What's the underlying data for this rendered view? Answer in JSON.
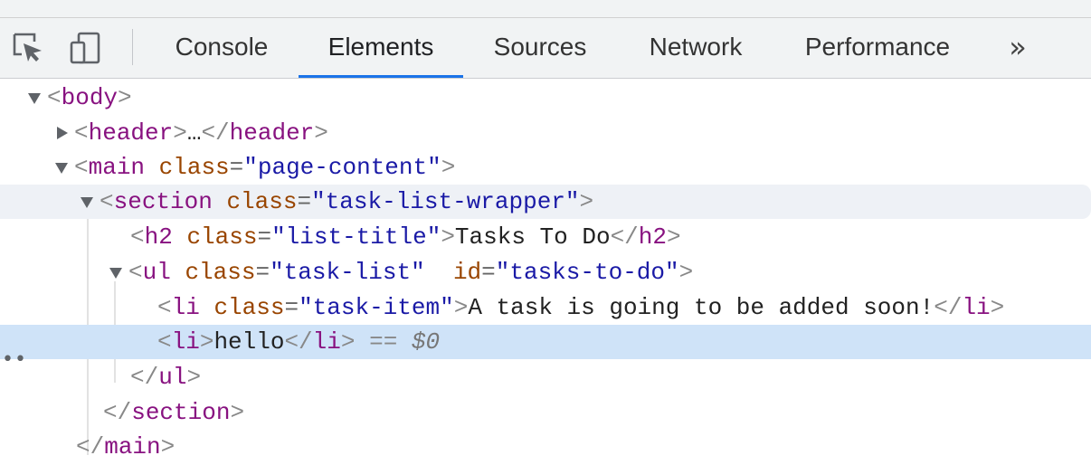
{
  "toolbar": {
    "inspect_icon": "inspect-element-icon",
    "device_icon": "device-toolbar-icon",
    "tabs": [
      {
        "label": "Console",
        "active": false
      },
      {
        "label": "Elements",
        "active": true
      },
      {
        "label": "Sources",
        "active": false
      },
      {
        "label": "Network",
        "active": false
      },
      {
        "label": "Performance",
        "active": false
      }
    ],
    "overflow": "»",
    "accent_color": "#1a73e8"
  },
  "dom_tree": {
    "body_open": "body",
    "header_tag": "header",
    "header_ellipsis": "…",
    "main_tag": "main",
    "main_class_attr": "class",
    "main_class_value": "page-content",
    "section_tag": "section",
    "section_class_attr": "class",
    "section_class_value": "task-list-wrapper",
    "h2_tag": "h2",
    "h2_class_attr": "class",
    "h2_class_value": "list-title",
    "h2_text": "Tasks To Do",
    "ul_tag": "ul",
    "ul_class_attr": "class",
    "ul_class_value": "task-list",
    "ul_id_attr": "id",
    "ul_id_value": "tasks-to-do",
    "li1_tag": "li",
    "li1_class_attr": "class",
    "li1_class_value": "task-item",
    "li1_text": "A task is going to be added soon!",
    "li2_tag": "li",
    "li2_text": "hello",
    "selected_marker": "== ",
    "selected_ref": "$0",
    "gutter_dots": "••"
  }
}
